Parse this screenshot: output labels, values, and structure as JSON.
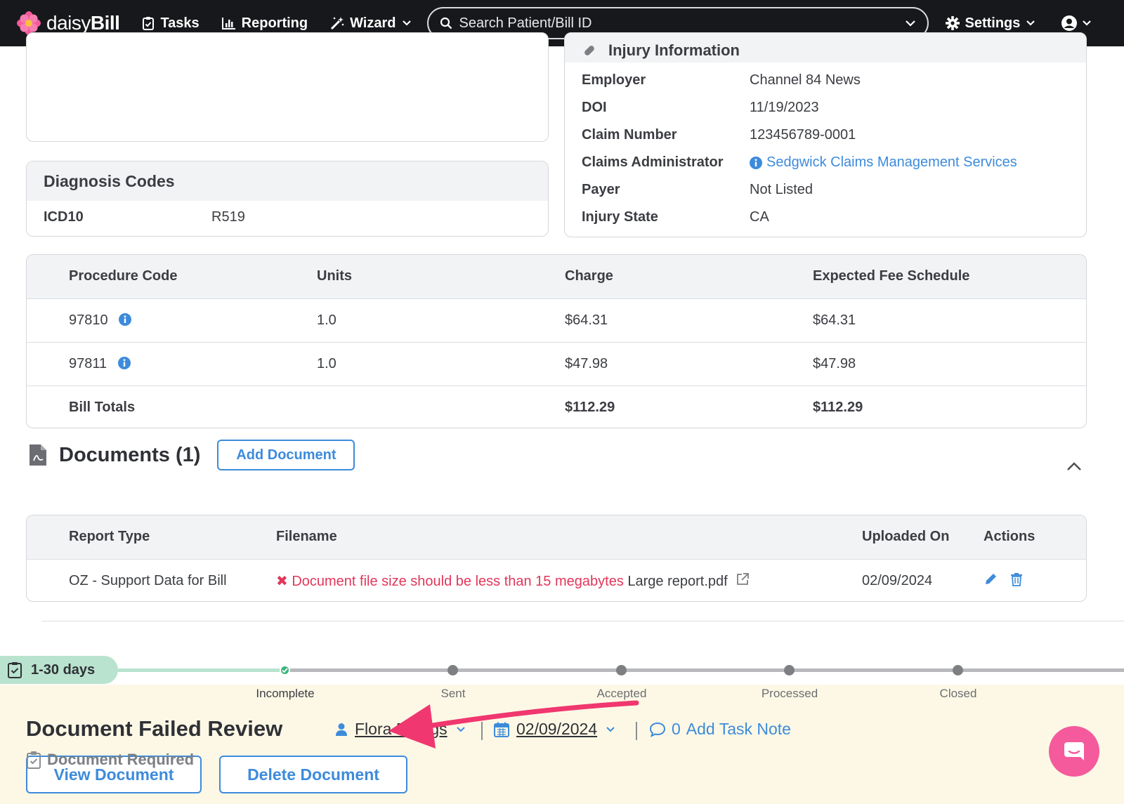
{
  "nav": {
    "brand_light": "daisy",
    "brand_bold": "Bill",
    "tasks": "Tasks",
    "reporting": "Reporting",
    "wizard": "Wizard",
    "search_placeholder": "Search Patient/Bill ID",
    "settings": "Settings"
  },
  "injury": {
    "header": "Injury Information",
    "rows": [
      {
        "label": "Employer",
        "value": "Channel 84 News"
      },
      {
        "label": "DOI",
        "value": "11/19/2023"
      },
      {
        "label": "Claim Number",
        "value": "123456789-0001"
      },
      {
        "label": "Claims Administrator",
        "value": "Sedgwick Claims Management Services"
      },
      {
        "label": "Payer",
        "value": "Not Listed"
      },
      {
        "label": "Injury State",
        "value": "CA"
      }
    ]
  },
  "diagnosis": {
    "header": "Diagnosis Codes",
    "type": "ICD10",
    "code": "R519"
  },
  "procedures": {
    "headers": [
      "Procedure Code",
      "Units",
      "Charge",
      "Expected Fee Schedule"
    ],
    "rows": [
      {
        "code": "97810",
        "units": "1.0",
        "charge": "$64.31",
        "expected": "$64.31"
      },
      {
        "code": "97811",
        "units": "1.0",
        "charge": "$47.98",
        "expected": "$47.98"
      }
    ],
    "totals_label": "Bill Totals",
    "total_charge": "$112.29",
    "total_expected": "$112.29"
  },
  "documents": {
    "title": "Documents (1)",
    "add_button": "Add Document",
    "headers": [
      "Report Type",
      "Filename",
      "Uploaded On",
      "Actions"
    ],
    "rows": [
      {
        "report_type": "OZ - Support Data for Bill",
        "error": "Document file size should be less than 15 megabytes",
        "filename": "Large report.pdf",
        "uploaded": "02/09/2024"
      }
    ]
  },
  "task": {
    "age_badge": "1-30 days",
    "stages": [
      "Incomplete",
      "Sent",
      "Accepted",
      "Processed",
      "Closed"
    ],
    "title": "Document Failed Review",
    "assignee": "Flora Billings",
    "date": "02/09/2024",
    "note_count": "0",
    "note_label": "Add Task Note",
    "view_button": "View Document",
    "delete_button": "Delete Document",
    "next_task": "Document Required"
  },
  "colors": {
    "accent": "#3d8bdb",
    "error": "#e2365b",
    "annotation_arrow": "#f0376f",
    "progress_done": "#b9e3cf",
    "task_bg": "#fdf8e6"
  }
}
